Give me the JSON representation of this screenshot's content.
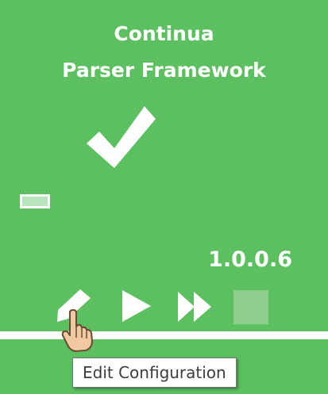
{
  "tile": {
    "title_line1": "Continua",
    "title_line2": "Parser Framework",
    "status_icon": "checkmark-icon",
    "version": "1.0.0.6",
    "actions": {
      "edit_icon": "pencil-icon",
      "run_icon": "play-icon",
      "fast_run_icon": "fast-forward-icon",
      "stop_icon": "stop-icon"
    },
    "colors": {
      "background": "#5cbf60",
      "stop_disabled": "#8ece8f",
      "indicator": "#b9e3ba"
    }
  },
  "cursor": {
    "icon": "hand-pointer-icon"
  },
  "tooltip": {
    "text": "Edit Configuration"
  }
}
